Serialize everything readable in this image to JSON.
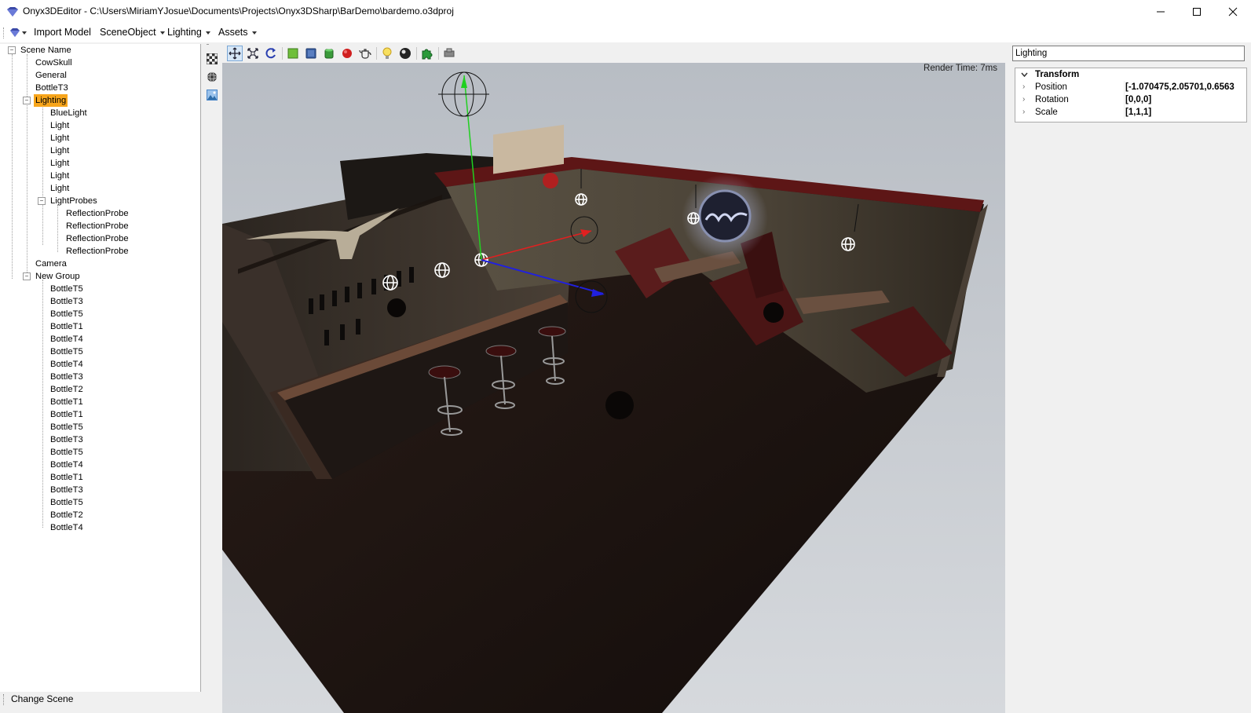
{
  "window": {
    "title": "Onyx3DEditor - C:\\Users\\MiriamYJosue\\Documents\\Projects\\Onyx3DSharp\\BarDemo\\bardemo.o3dproj",
    "controls": [
      "minimize-icon",
      "maximize-icon",
      "close-icon"
    ]
  },
  "menu": {
    "items": [
      {
        "label": "Import Model",
        "dropdown": false
      },
      {
        "label": "SceneObject",
        "dropdown": true
      },
      {
        "label": "Lighting",
        "dropdown": true
      },
      {
        "label": "Assets",
        "dropdown": true
      }
    ]
  },
  "tree": {
    "root": "Scene Name",
    "top": [
      "CowSkull",
      "General",
      "BottleT3"
    ],
    "lighting": "Lighting",
    "lights": [
      "BlueLight",
      "Light",
      "Light",
      "Light",
      "Light",
      "Light",
      "Light"
    ],
    "probes_label": "LightProbes",
    "probes": [
      "ReflectionProbe",
      "ReflectionProbe",
      "ReflectionProbe",
      "ReflectionProbe"
    ],
    "camera": "Camera",
    "group": "New Group",
    "group_items": [
      "BottleT5",
      "BottleT3",
      "BottleT5",
      "BottleT1",
      "BottleT4",
      "BottleT5",
      "BottleT4",
      "BottleT3",
      "BottleT2",
      "BottleT1",
      "BottleT1",
      "BottleT5",
      "BottleT3",
      "BottleT5",
      "BottleT4",
      "BottleT1",
      "BottleT3",
      "BottleT5",
      "BottleT2",
      "BottleT4"
    ]
  },
  "bottom": {
    "change_scene": "Change Scene"
  },
  "viewport": {
    "render_time": "Render Time: 7ms"
  },
  "inspector": {
    "search_value": "Lighting",
    "section": "Transform",
    "properties": [
      {
        "name": "Position",
        "value": "[-1.070475,2.05701,0.6563"
      },
      {
        "name": "Rotation",
        "value": "[0,0,0]"
      },
      {
        "name": "Scale",
        "value": "[1,1,1]"
      }
    ]
  },
  "colors": {
    "selection": "#f7a51b",
    "viewport_bg": "#c9ccd1",
    "gizmo_x": "#e02020",
    "gizmo_y": "#20d020",
    "gizmo_z": "#2020e0"
  }
}
